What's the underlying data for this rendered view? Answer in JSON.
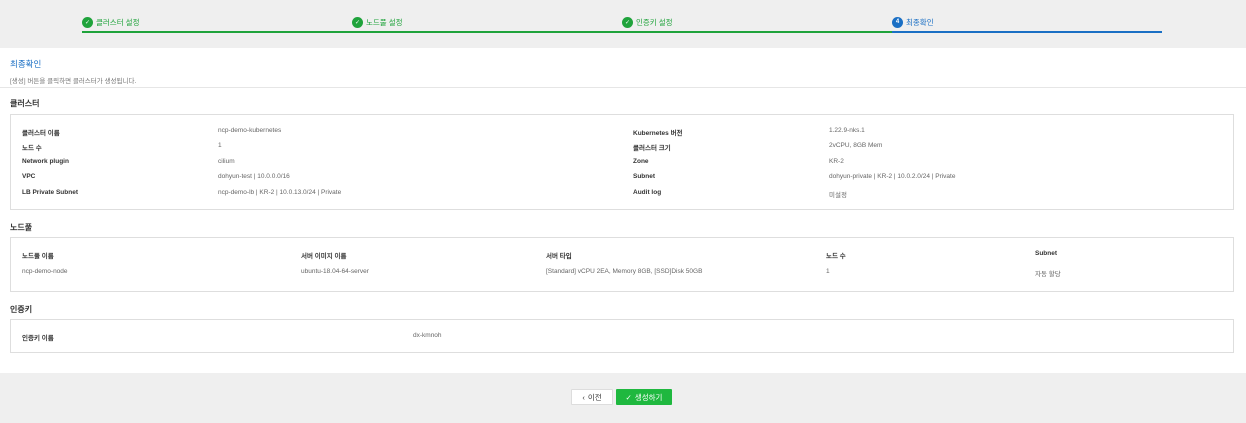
{
  "stepper": {
    "steps": [
      {
        "label": "클러스터 설정",
        "state": "done",
        "icon": "check-icon"
      },
      {
        "label": "노드풀 설정",
        "state": "done",
        "icon": "check-icon"
      },
      {
        "label": "인증키 설정",
        "state": "done",
        "icon": "check-icon"
      },
      {
        "label": "최종확인",
        "state": "current",
        "number": "4"
      }
    ]
  },
  "intro": {
    "title": "최종확인",
    "description": "[생성] 버튼을 클릭하면 클러스터가 생성됩니다."
  },
  "cluster": {
    "title": "클러스터",
    "left": [
      {
        "label": "클러스터 이름",
        "value": "ncp-demo-kubernetes"
      },
      {
        "label": "노드 수",
        "value": "1"
      },
      {
        "label": "Network plugin",
        "value": "cilium"
      },
      {
        "label": "VPC",
        "value": "dohyun-test | 10.0.0.0/16"
      },
      {
        "label": "LB Private Subnet",
        "value": "ncp-demo-lb | KR-2 | 10.0.13.0/24 | Private"
      }
    ],
    "right": [
      {
        "label": "Kubernetes 버전",
        "value": "1.22.9-nks.1"
      },
      {
        "label": "클러스터 크기",
        "value": "2vCPU, 8GB Mem"
      },
      {
        "label": "Zone",
        "value": "KR-2"
      },
      {
        "label": "Subnet",
        "value": "dohyun-private | KR-2 | 10.0.2.0/24 | Private"
      },
      {
        "label": "Audit log",
        "value": "미설정"
      }
    ]
  },
  "nodepool": {
    "title": "노드풀",
    "headers": [
      "노드풀 이름",
      "서버 이미지 이름",
      "서버 타입",
      "노드 수",
      "Subnet"
    ],
    "rows": [
      [
        "ncp-demo-node",
        "ubuntu-18.04-64-server",
        "[Standard] vCPU 2EA, Memory 8GB, [SSD]Disk 50GB",
        "1",
        "자동 할당"
      ]
    ]
  },
  "authkey": {
    "title": "인증키",
    "label": "인증키 이름",
    "value": "dx-kmnoh"
  },
  "footer": {
    "prev_label": "이전",
    "create_label": "생성하기"
  }
}
